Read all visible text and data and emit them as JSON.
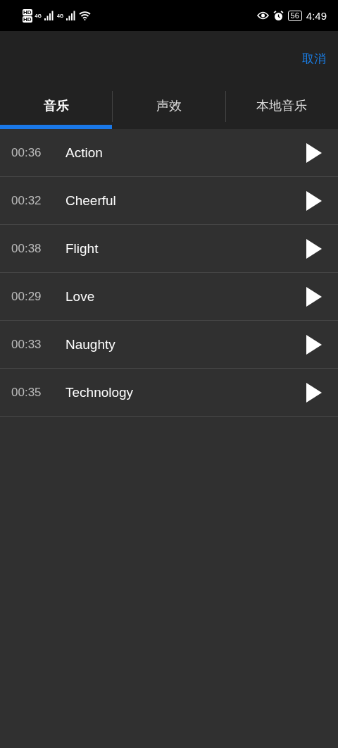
{
  "status_bar": {
    "sim_labels": [
      "HD",
      "HD"
    ],
    "network_labels": [
      "4G",
      "4G"
    ],
    "battery": "56",
    "time": "4:49"
  },
  "header": {
    "cancel": "取消"
  },
  "tabs": [
    {
      "label": "音乐",
      "selected": true
    },
    {
      "label": "声效",
      "selected": false
    },
    {
      "label": "本地音乐",
      "selected": false
    }
  ],
  "tracks": [
    {
      "duration": "00:36",
      "title": "Action"
    },
    {
      "duration": "00:32",
      "title": "Cheerful"
    },
    {
      "duration": "00:38",
      "title": "Flight"
    },
    {
      "duration": "00:29",
      "title": "Love"
    },
    {
      "duration": "00:33",
      "title": "Naughty"
    },
    {
      "duration": "00:35",
      "title": "Technology"
    }
  ]
}
